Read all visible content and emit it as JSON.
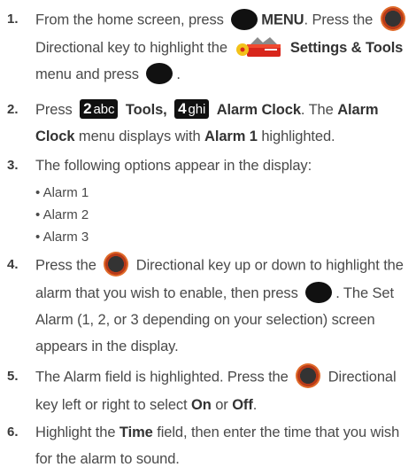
{
  "steps": [
    {
      "number": "1.",
      "segments": {
        "a": "From the home screen, press",
        "b": "MENU",
        "c": ". Press the",
        "d": "Directional key to highlight the",
        "e": "Settings & Tools",
        "f": "menu and press",
        "g": "."
      }
    },
    {
      "number": "2.",
      "segments": {
        "a": "Press",
        "key1": "2",
        "key1_letters": "abc",
        "b": "Tools,",
        "key2": "4",
        "key2_letters": "ghi",
        "c": "Alarm Clock",
        "d": ". The",
        "e": "Alarm Clock",
        "f": "menu displays with",
        "g": "Alarm 1",
        "h": "highlighted."
      }
    },
    {
      "number": "3.",
      "segments": {
        "a": "The following options appear in the display:"
      },
      "bullets": [
        "• Alarm 1",
        "• Alarm 2",
        "• Alarm 3"
      ]
    },
    {
      "number": "4.",
      "segments": {
        "a": "Press the",
        "b": "Directional key up or down to highlight the alarm that you wish to enable, then press",
        "c": ". The Set Alarm (1, 2, or 3 depending on your selection) screen appears in the display."
      }
    },
    {
      "number": "5.",
      "segments": {
        "a": "The Alarm field is highlighted. Press the",
        "b": "Directional key left or right to select",
        "c": "On",
        "d": "or",
        "e": "Off",
        "f": "."
      }
    },
    {
      "number": "6.",
      "segments": {
        "a": "Highlight the",
        "b": "Time",
        "c": "field, then enter the time that you wish for the alarm to sound."
      }
    }
  ],
  "icons": {
    "ok_key": "ok-key-icon",
    "directional_key": "directional-key-icon",
    "settings_tools": "settings-tools-icon"
  },
  "colors": {
    "text": "#4a4a4a",
    "keycap": "#111111",
    "key_ring": "#e06a2a"
  }
}
